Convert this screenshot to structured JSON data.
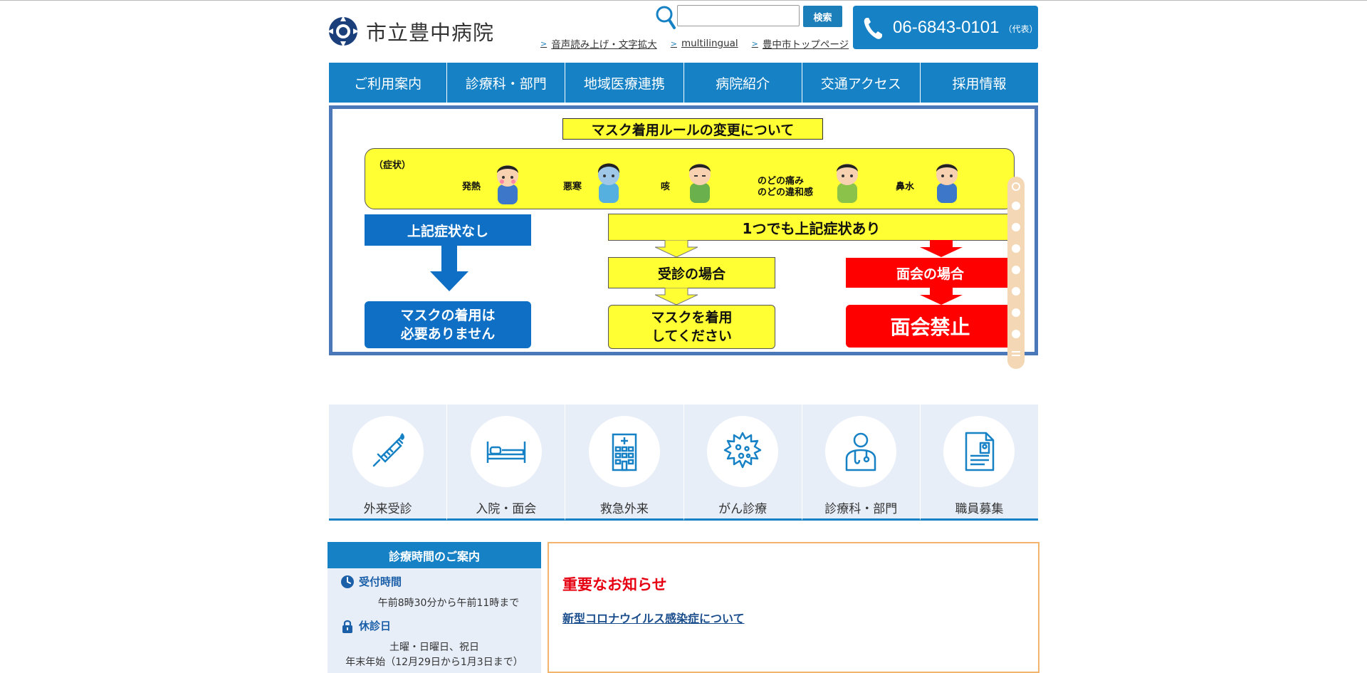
{
  "header": {
    "logo_text": "市立豊中病院",
    "search": {
      "placeholder": "",
      "value": "",
      "button_label": "検索"
    },
    "util_links": [
      "音声読み上げ・文字拡大",
      "multilingual",
      "豊中市トップページ"
    ],
    "phone": {
      "number": "06-6843-0101",
      "note": "（代表）"
    }
  },
  "nav": {
    "items": [
      "ご利用案内",
      "診療科・部門",
      "地域医療連携",
      "病院紹介",
      "交通アクセス",
      "採用情報"
    ]
  },
  "banner": {
    "title": "マスク着用ルールの変更について",
    "symptom_label": "（症状）",
    "symptoms": [
      "発熱",
      "悪寒",
      "咳",
      "のどの痛み",
      "のどの違和感",
      "鼻水"
    ],
    "no_symptom": "上記症状なし",
    "no_mask_line1": "マスクの着用は",
    "no_mask_line2": "必要ありません",
    "any_symptom": "1つでも上記症状あり",
    "consult": "受診の場合",
    "wear_mask_line1": "マスクを着用",
    "wear_mask_line2": "してください",
    "visit": "面会の場合",
    "no_visit": "面会禁止",
    "slide_count": 8,
    "active_slide": 1
  },
  "tiles": [
    {
      "label": "外来受診",
      "icon": "syringe-icon"
    },
    {
      "label": "入院・面会",
      "icon": "bed-icon"
    },
    {
      "label": "救急外来",
      "icon": "hospital-building-icon"
    },
    {
      "label": "がん診療",
      "icon": "cancer-cell-icon"
    },
    {
      "label": "診療科・部門",
      "icon": "doctor-icon"
    },
    {
      "label": "職員募集",
      "icon": "resume-document-icon"
    }
  ],
  "hours": {
    "title": "診療時間のご案内",
    "reception_label": "受付時間",
    "reception_text": "午前8時30分から午前11時まで",
    "closed_label": "休診日",
    "closed_text1": "土曜・日曜日、祝日",
    "closed_text2": "年末年始（12月29日から1月3日まで）"
  },
  "notice": {
    "title": "重要なお知らせ",
    "link": "新型コロナウイルス感染症について"
  },
  "colors": {
    "primary_blue": "#1682c5",
    "banner_border": "#4a78b8",
    "notice_red": "#e60012",
    "notice_border": "#f3b46e",
    "tile_bg": "#e7eef8"
  }
}
